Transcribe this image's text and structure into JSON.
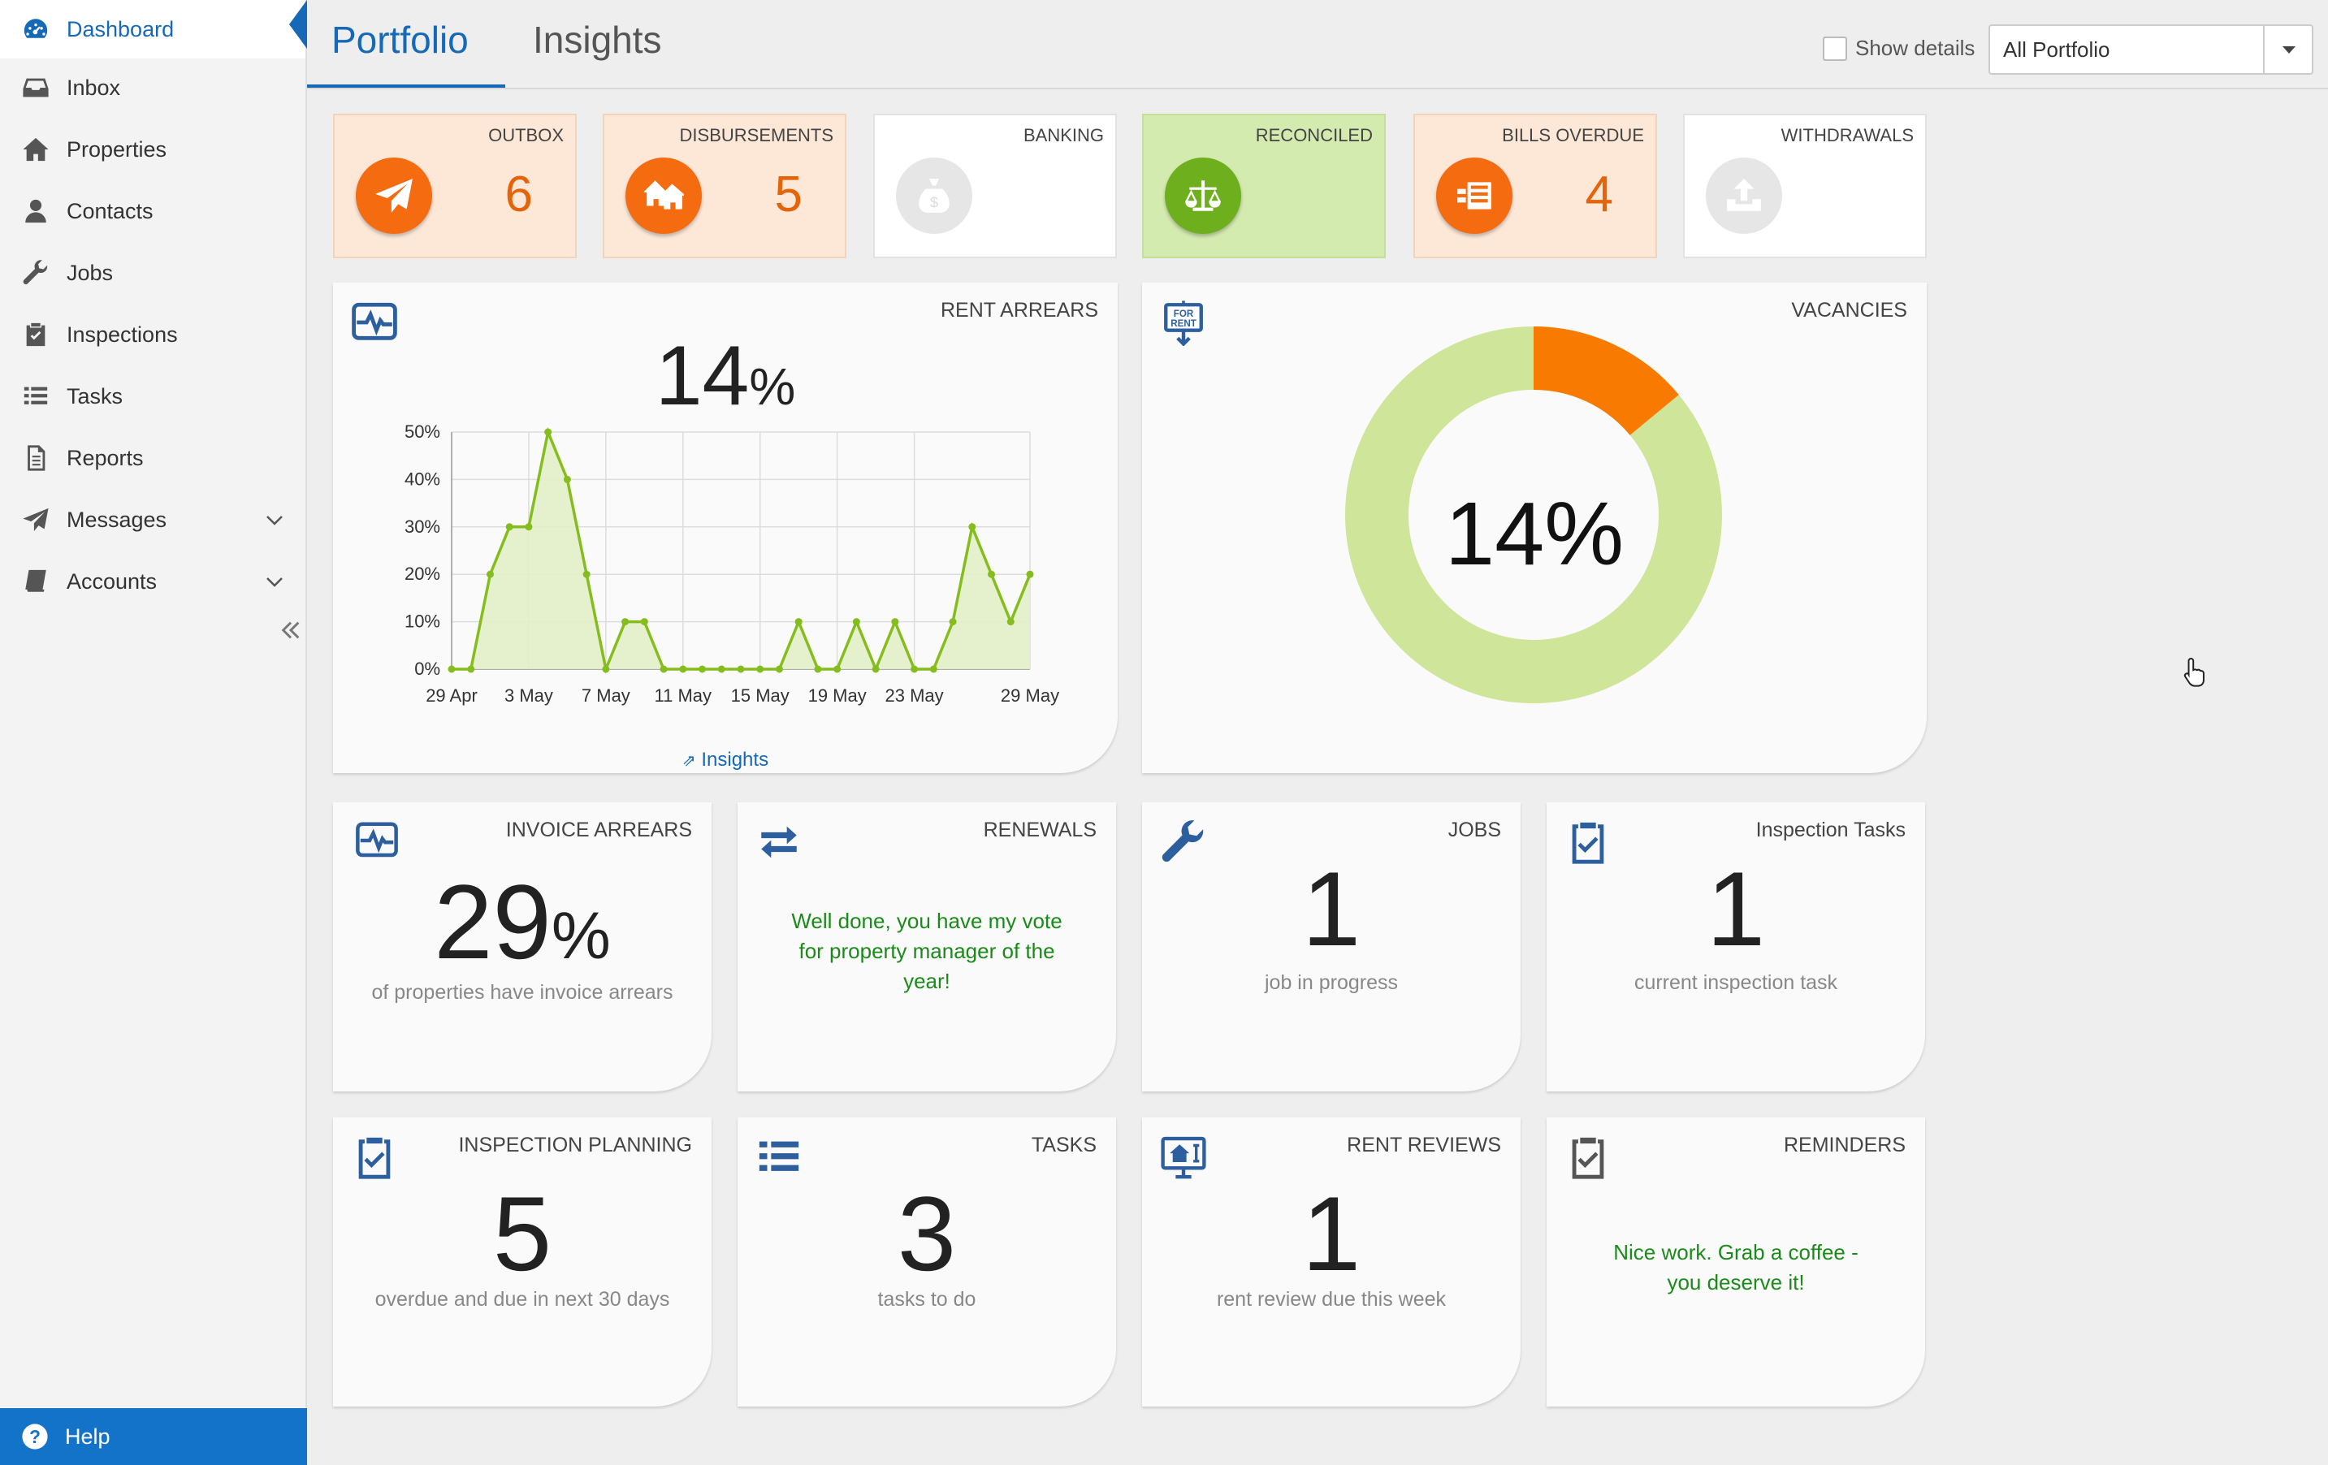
{
  "sidebar": {
    "items": [
      {
        "label": "Dashboard",
        "icon": "dashboard-icon"
      },
      {
        "label": "Inbox",
        "icon": "inbox-icon"
      },
      {
        "label": "Properties",
        "icon": "home-icon"
      },
      {
        "label": "Contacts",
        "icon": "user-icon"
      },
      {
        "label": "Jobs",
        "icon": "wrench-icon"
      },
      {
        "label": "Inspections",
        "icon": "clipboard-check-icon"
      },
      {
        "label": "Tasks",
        "icon": "list-icon"
      },
      {
        "label": "Reports",
        "icon": "document-icon"
      },
      {
        "label": "Messages",
        "icon": "paper-plane-icon"
      },
      {
        "label": "Accounts",
        "icon": "book-icon"
      }
    ],
    "help_label": "Help"
  },
  "header": {
    "tabs": [
      {
        "label": "Portfolio"
      },
      {
        "label": "Insights"
      }
    ],
    "show_details_label": "Show details",
    "portfolio_select": "All Portfolio"
  },
  "summary": [
    {
      "label": "OUTBOX",
      "count": "6"
    },
    {
      "label": "DISBURSEMENTS",
      "count": "5"
    },
    {
      "label": "BANKING",
      "count": ""
    },
    {
      "label": "RECONCILED",
      "count": ""
    },
    {
      "label": "BILLS OVERDUE",
      "count": "4"
    },
    {
      "label": "WITHDRAWALS",
      "count": ""
    }
  ],
  "rent_arrears": {
    "title": "RENT ARREARS",
    "value": "14",
    "unit": "%",
    "link": "Insights"
  },
  "vacancies": {
    "title": "VACANCIES",
    "value": "14%",
    "fraction": 0.14,
    "colors": {
      "vacant": "#f97a00",
      "occupied": "#cfe59a"
    }
  },
  "cards": {
    "invoice_arrears": {
      "title": "INVOICE ARREARS",
      "value": "29",
      "unit": "%",
      "sub": "of properties have invoice arrears"
    },
    "renewals": {
      "title": "RENEWALS",
      "message": "Well done, you have my vote for property manager of the year!"
    },
    "jobs": {
      "title": "JOBS",
      "value": "1",
      "sub": "job in progress"
    },
    "inspection_tasks": {
      "title": "Inspection Tasks",
      "value": "1",
      "sub": "current inspection task"
    },
    "inspection_planning": {
      "title": "INSPECTION PLANNING",
      "value": "5",
      "sub": "overdue and due in next 30 days"
    },
    "tasks": {
      "title": "TASKS",
      "value": "3",
      "sub": "tasks to do"
    },
    "rent_reviews": {
      "title": "RENT REVIEWS",
      "value": "1",
      "sub": "rent review due this week"
    },
    "reminders": {
      "title": "REMINDERS",
      "message": "Nice work. Grab a coffee - you deserve it!"
    }
  },
  "chart_data": {
    "type": "area",
    "title": "",
    "xlabel": "",
    "ylabel": "",
    "ylim": [
      0,
      50
    ],
    "y_ticks": [
      "0%",
      "10%",
      "20%",
      "30%",
      "40%",
      "50%"
    ],
    "x_ticks": [
      "29 Apr",
      "3 May",
      "7 May",
      "11 May",
      "15 May",
      "19 May",
      "23 May",
      "29 May"
    ],
    "x_tick_days": [
      0,
      4,
      8,
      12,
      16,
      20,
      24,
      30
    ],
    "x_days": [
      0,
      1,
      2,
      3,
      4,
      5,
      6,
      7,
      8,
      9,
      10,
      11,
      12,
      13,
      14,
      15,
      16,
      17,
      18,
      19,
      20,
      21,
      22,
      23,
      24,
      25,
      26,
      27,
      28,
      29,
      30
    ],
    "values": [
      0,
      0,
      20,
      30,
      30,
      50,
      40,
      20,
      0,
      10,
      10,
      0,
      0,
      0,
      0,
      0,
      0,
      0,
      10,
      0,
      0,
      10,
      0,
      10,
      0,
      0,
      10,
      30,
      20,
      10,
      20
    ],
    "grid": true,
    "colors": {
      "line": "#86bd1e",
      "fill": "#e2efc6"
    }
  }
}
